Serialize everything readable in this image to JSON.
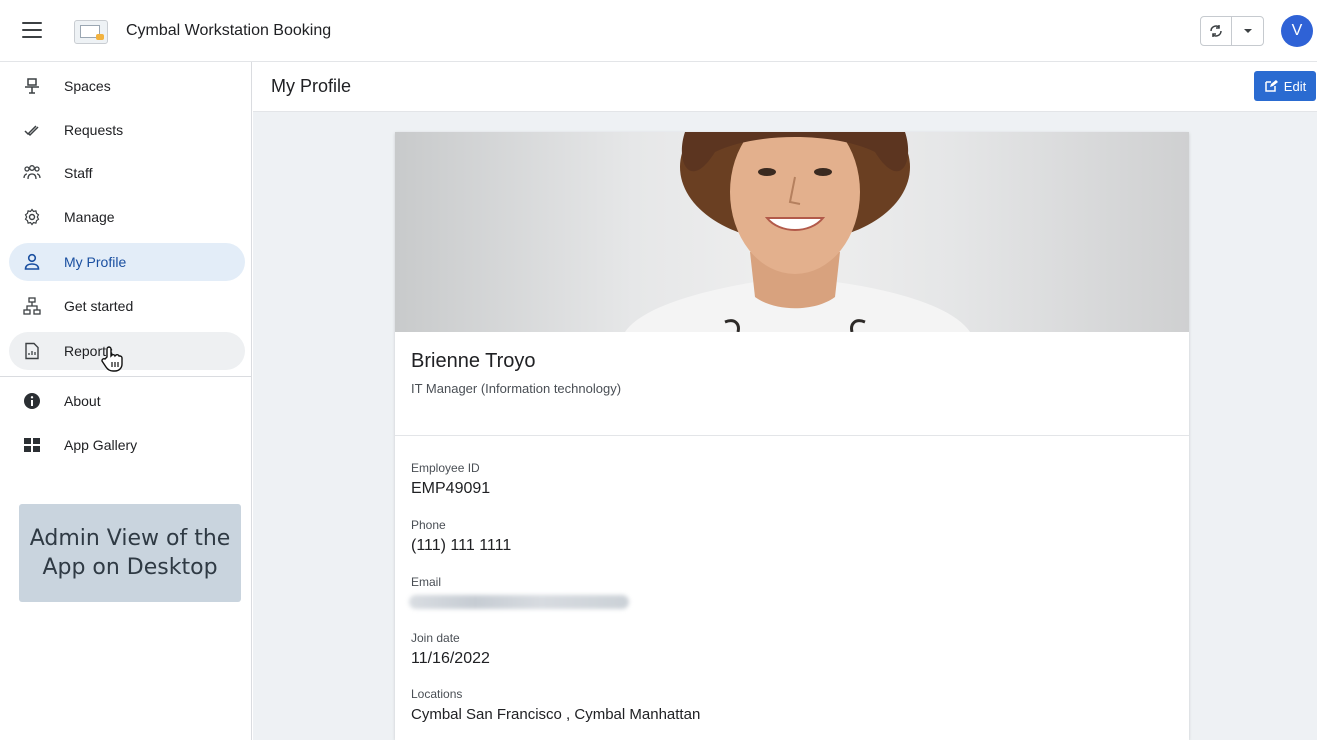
{
  "app": {
    "title": "Cymbal Workstation Booking",
    "user_initial": "V"
  },
  "sidebar": {
    "items": [
      {
        "label": "Spaces",
        "icon": "desk-icon"
      },
      {
        "label": "Requests",
        "icon": "checkmarks-icon"
      },
      {
        "label": "Staff",
        "icon": "group-icon"
      },
      {
        "label": "Manage",
        "icon": "gear-icon"
      },
      {
        "label": "My Profile",
        "icon": "person-icon",
        "active": true
      },
      {
        "label": "Get started",
        "icon": "sitemap-icon"
      },
      {
        "label": "Reports",
        "icon": "report-icon"
      }
    ],
    "secondary": [
      {
        "label": "About",
        "icon": "info-icon"
      },
      {
        "label": "App Gallery",
        "icon": "grid-icon"
      }
    ],
    "callout": {
      "line1": "Admin View of the",
      "line2": "App on Desktop"
    }
  },
  "page": {
    "title": "My Profile",
    "edit_label": "Edit"
  },
  "profile": {
    "name": "Brienne Troyo",
    "role": "IT Manager (Information technology)",
    "fields": {
      "employee_id": {
        "label": "Employee ID",
        "value": "EMP49091"
      },
      "phone": {
        "label": "Phone",
        "value": "(111) 111 1111"
      },
      "email": {
        "label": "Email"
      },
      "join_date": {
        "label": "Join date",
        "value": "11/16/2022"
      },
      "locations": {
        "label": "Locations",
        "value": "Cymbal San Francisco , Cymbal Manhattan"
      }
    }
  },
  "colors": {
    "accent": "#2a6bd1",
    "avatar": "#2f62d6",
    "active_nav": "#e3edf8"
  }
}
